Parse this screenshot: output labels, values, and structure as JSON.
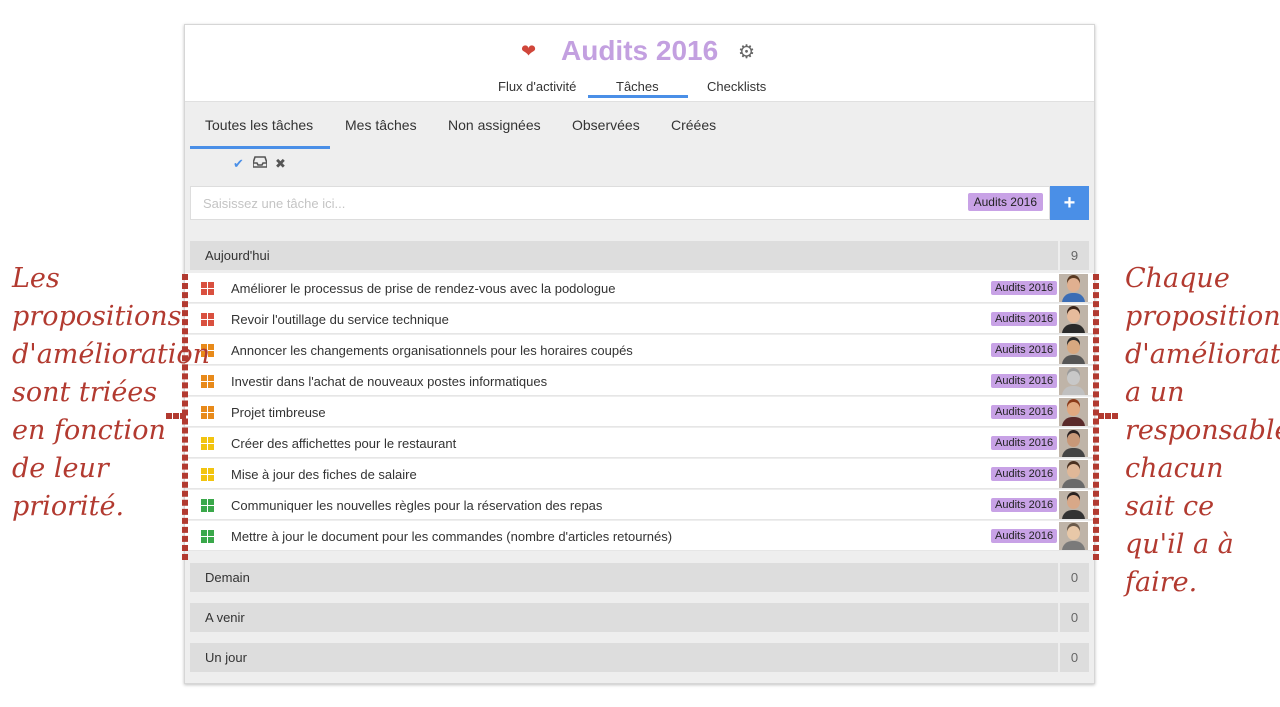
{
  "header": {
    "heart_icon": "heart-icon",
    "title": "Audits 2016",
    "gear_icon": "gear-icon",
    "tabs": [
      "Flux d'activité",
      "Tâches",
      "Checklists"
    ],
    "active_tab": "Tâches"
  },
  "subtabs": [
    "Toutes les tâches",
    "Mes tâches",
    "Non assignées",
    "Observées",
    "Créées"
  ],
  "active_subtab": "Toutes les tâches",
  "actions": [
    "check-icon",
    "inbox-icon",
    "close-icon"
  ],
  "new_task": {
    "placeholder": "Saisissez une tâche ici...",
    "project_tag": "Audits 2016",
    "add_label": "+"
  },
  "sections": [
    {
      "label": "Aujourd'hui",
      "count": "9"
    },
    {
      "label": "Demain",
      "count": "0"
    },
    {
      "label": "A venir",
      "count": "0"
    },
    {
      "label": "Un jour",
      "count": "0"
    }
  ],
  "priority_colors": {
    "red": "#d9503f",
    "orange": "#e88a1a",
    "yellow": "#f2c40f",
    "green": "#3aa84a"
  },
  "tasks": [
    {
      "name": "Améliorer le processus de prise de rendez-vous avec la podologue",
      "tag": "Audits 2016",
      "priority": "red"
    },
    {
      "name": "Revoir l'outillage du service technique",
      "tag": "Audits 2016",
      "priority": "red"
    },
    {
      "name": "Annoncer les changements organisationnels pour les horaires coupés",
      "tag": "Audits 2016",
      "priority": "orange"
    },
    {
      "name": "Investir dans l'achat de nouveaux postes informatiques",
      "tag": "Audits 2016",
      "priority": "orange"
    },
    {
      "name": "Projet timbreuse",
      "tag": "Audits 2016",
      "priority": "orange"
    },
    {
      "name": "Créer des affichettes pour le restaurant",
      "tag": "Audits 2016",
      "priority": "yellow"
    },
    {
      "name": "Mise à jour des fiches de salaire",
      "tag": "Audits 2016",
      "priority": "yellow"
    },
    {
      "name": "Communiquer les nouvelles règles pour la réservation des repas",
      "tag": "Audits 2016",
      "priority": "green"
    },
    {
      "name": "Mettre à jour le document pour les commandes (nombre d'articles retournés)",
      "tag": "Audits 2016",
      "priority": "green"
    }
  ],
  "annotations": {
    "left": "Les propositions d'amélioration sont triées en fonction de leur priorité.",
    "right": "Chaque proposition d'amélioration a un responsable, chacun sait ce qu'il a à faire."
  }
}
